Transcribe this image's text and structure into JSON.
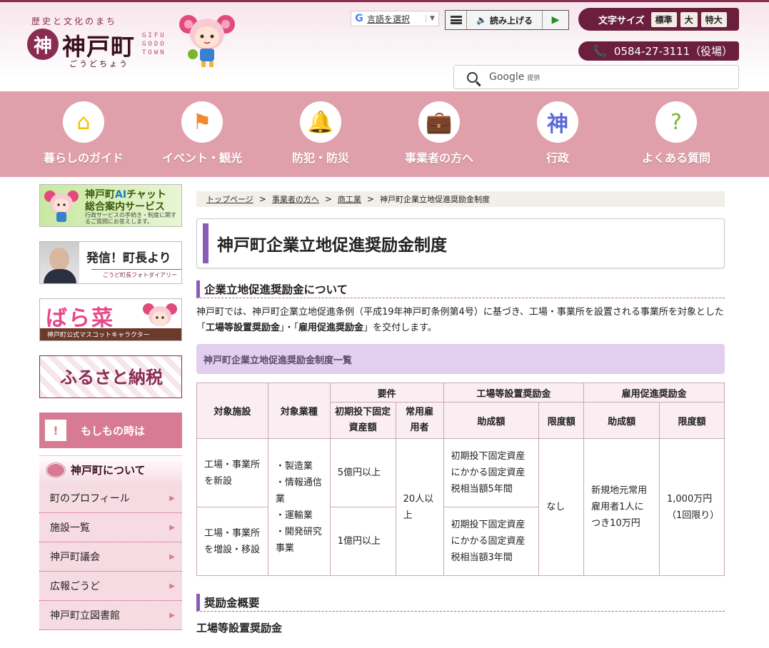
{
  "header": {
    "tagline": "歴史と文化のまち",
    "logo_mark": "神",
    "logo_name": "神戸町",
    "logo_kana": "ごうどちょう",
    "logo_en": "GIFU GODO TOWN",
    "language_label": "言語を選択",
    "read_aloud_label": "読み上げる",
    "font_size_label": "文字サイズ",
    "font_sizes": [
      "標準",
      "大",
      "特大"
    ],
    "phone": "0584-27-3111（役場）",
    "search_brand": "Google",
    "search_provided": "提供"
  },
  "nav": [
    {
      "label": "暮らしのガイド",
      "icon": "house-hand-icon",
      "glyph": "⌂",
      "color": "#f2c300"
    },
    {
      "label": "イベント・観光",
      "icon": "flag-icon",
      "glyph": "⚑",
      "color": "#f08a2c"
    },
    {
      "label": "防犯・防災",
      "icon": "bell-icon",
      "glyph": "🔔",
      "color": "#d32a2a"
    },
    {
      "label": "事業者の方へ",
      "icon": "briefcase-icon",
      "glyph": "💼",
      "color": "#9b4fb8"
    },
    {
      "label": "行政",
      "icon": "town-emblem-icon",
      "glyph": "神",
      "color": "#5a6ad6"
    },
    {
      "label": "よくある質問",
      "icon": "question-icon",
      "glyph": "?",
      "color": "#7ab52a"
    }
  ],
  "sidebar": {
    "banners": {
      "ai_chat_title_prefix": "神戸町",
      "ai_chat_title_ai": "AI",
      "ai_chat_title_suffix": "チャット",
      "ai_chat_line2": "総合案内サービス",
      "ai_chat_note": "行政サービスの手続き・制度に関するご質問にお答えします。",
      "mayor_title": "発信！町長より",
      "mayor_sub": "ごうど町長フォトダイアリー",
      "mascot_title": "ばら菜",
      "mascot_sub": "神戸町公式マスコットキャラクター",
      "furusato": "ふるさと納税"
    },
    "emergency_mark": "!",
    "emergency_label": "もしもの時は",
    "about_title": "神戸町について",
    "about_items": [
      "町のプロフィール",
      "施設一覧",
      "神戸町議会",
      "広報ごうど",
      "神戸町立図書館"
    ]
  },
  "breadcrumb": [
    "トップページ",
    "事業者の方へ",
    "商工業",
    "神戸町企業立地促進奨励金制度"
  ],
  "main": {
    "title": "神戸町企業立地促進奨励金制度",
    "section1": "企業立地促進奨励金について",
    "intro_1": "神戸町では、神戸町企業立地促進条例（平成19年神戸町条例第4号）に基づき、工場・事業所を設置される事業所を対象とした「",
    "intro_b1": "工場等設置奨励金",
    "intro_2": "」・「",
    "intro_b2": "雇用促進奨励金",
    "intro_3": "」を交付します。",
    "list_heading": "神戸町企業立地促進奨励金制度一覧",
    "section2": "奨励金概要",
    "section3": "工場等設置奨励金"
  },
  "table": {
    "h_facility": "対象施設",
    "h_industry": "対象業種",
    "h_requirements": "要件",
    "h_factory": "工場等設置奨励金",
    "h_employment": "雇用促進奨励金",
    "h_investment": "初期投下固定資産額",
    "h_employees": "常用雇用者",
    "h_amount": "助成額",
    "h_limit": "限度額",
    "h_amount2": "助成額",
    "h_limit2": "限度額",
    "row1_facility": "工場・事業所を新設",
    "row2_facility": "工場・事業所を増設・移設",
    "industries": "・製造業\n・情報通信業\n・運輸業\n・開発研究事業",
    "row1_investment": "5億円以上",
    "row2_investment": "1億円以上",
    "employees": "20人以上",
    "row1_amount": "初期投下固定資産にかかる固定資産税相当額5年間",
    "row2_amount": "初期投下固定資産にかかる固定資産税相当額3年間",
    "factory_limit": "なし",
    "employment_amount": "新規地元常用雇用者1人につき10万円",
    "employment_limit": "1,000万円（1回限り）"
  }
}
